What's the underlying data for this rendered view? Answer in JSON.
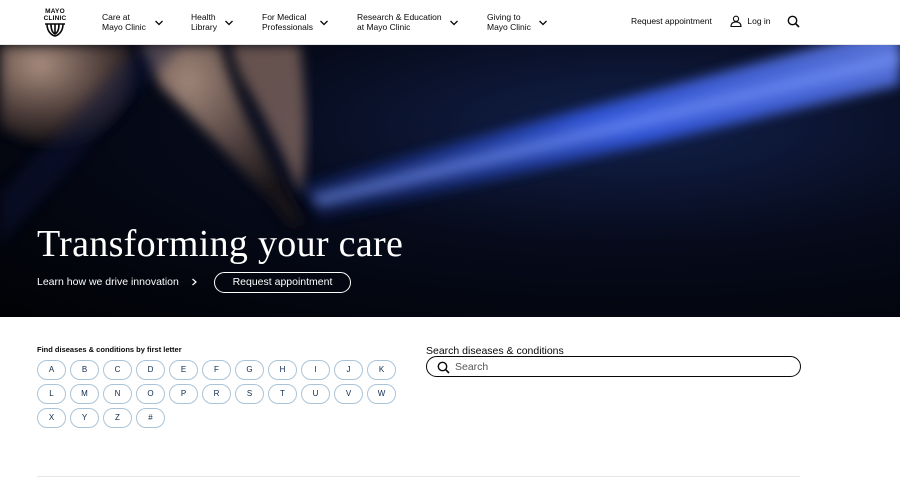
{
  "logo": {
    "line1": "MAYO",
    "line2": "CLINIC",
    "icon": "mayo-shield-icon"
  },
  "nav": [
    {
      "line1": "Care at",
      "line2": "Mayo Clinic"
    },
    {
      "line1": "Health",
      "line2": "Library"
    },
    {
      "line1": "For Medical",
      "line2": "Professionals"
    },
    {
      "line1": "Research & Education",
      "line2": "at Mayo Clinic"
    },
    {
      "line1": "Giving to",
      "line2": "Mayo Clinic"
    }
  ],
  "utility": {
    "request_appointment": "Request appointment",
    "login": "Log in",
    "login_icon": "user-icon",
    "search_icon": "search-icon"
  },
  "hero": {
    "title": "Transforming your care",
    "link_label": "Learn how we drive innovation",
    "link_icon": "chevron-right-icon",
    "button_label": "Request appointment"
  },
  "az": {
    "heading": "Find diseases & conditions by first letter",
    "letters": [
      "A",
      "B",
      "C",
      "D",
      "E",
      "F",
      "G",
      "H",
      "I",
      "J",
      "K",
      "L",
      "M",
      "N",
      "O",
      "P",
      "R",
      "S",
      "T",
      "U",
      "V",
      "W",
      "X",
      "Y",
      "Z",
      "#"
    ]
  },
  "search": {
    "label": "Search diseases & conditions",
    "placeholder": "Search",
    "icon": "search-icon"
  },
  "colors": {
    "text": "#080808",
    "letter_border": "#a9c4d9",
    "letter_text": "#0d2a4d",
    "hero_dark": "#060a1a",
    "hero_accent": "#2c52d8"
  }
}
